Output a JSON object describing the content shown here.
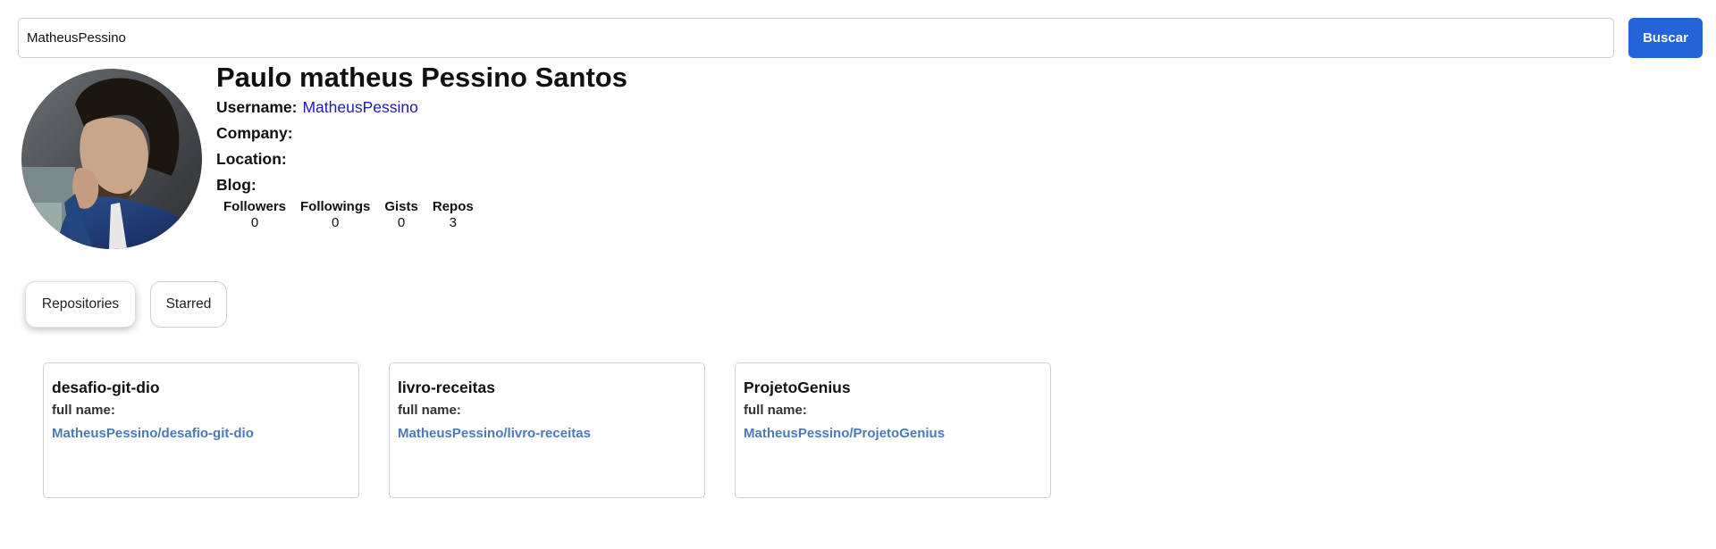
{
  "search": {
    "value": "MatheusPessino",
    "button_label": "Buscar"
  },
  "profile": {
    "avatar_icon": "profile-photo",
    "name": "Paulo matheus Pessino Santos",
    "username_label": "Username:",
    "username": "MatheusPessino",
    "company_label": "Company:",
    "company": "",
    "location_label": "Location:",
    "location": "",
    "blog_label": "Blog:",
    "blog": "",
    "stats": [
      {
        "label": "Followers",
        "value": "0"
      },
      {
        "label": "Followings",
        "value": "0"
      },
      {
        "label": "Gists",
        "value": "0"
      },
      {
        "label": "Repos",
        "value": "3"
      }
    ]
  },
  "tabs": [
    {
      "label": "Repositories",
      "active": true
    },
    {
      "label": "Starred",
      "active": false
    }
  ],
  "repos": [
    {
      "name": "desafio-git-dio",
      "full_name_label": "full name:",
      "full_name": "MatheusPessino/desafio-git-dio"
    },
    {
      "name": "livro-receitas",
      "full_name_label": "full name:",
      "full_name": "MatheusPessino/livro-receitas"
    },
    {
      "name": "ProjetoGenius",
      "full_name_label": "full name:",
      "full_name": "MatheusPessino/ProjetoGenius"
    }
  ],
  "colors": {
    "primary_button": "#2563d9",
    "username_link": "#1a1ab8",
    "repo_link": "#4a7ab8",
    "border": "#cfcfcf"
  }
}
